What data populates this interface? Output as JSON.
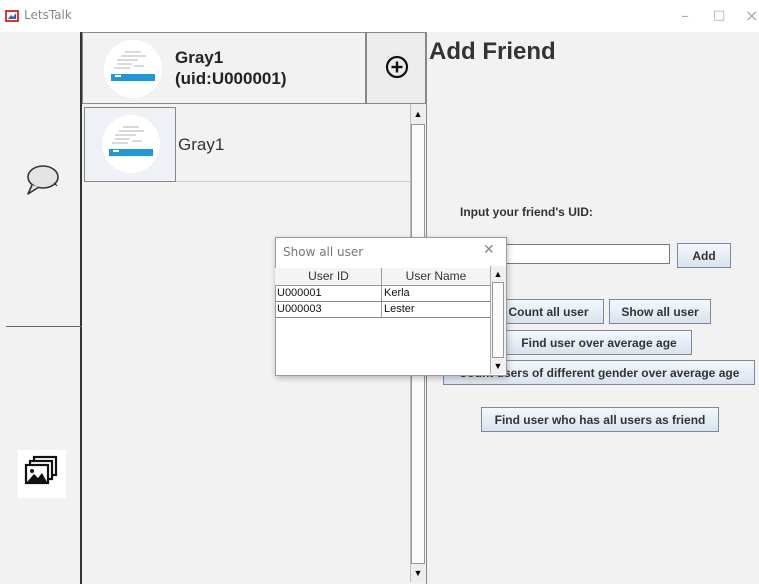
{
  "window": {
    "title": "LetsTalk"
  },
  "profile": {
    "name": "Gray1",
    "uid_line": "(uid:U000001)"
  },
  "chat_list": [
    {
      "name": "Gray1"
    }
  ],
  "add_friend": {
    "heading": "Add Friend",
    "uid_label": "Input your friend's UID:",
    "uid_value": "",
    "add_label": "Add",
    "count_label": "Count all user",
    "show_label": "Show all user",
    "avg_age_label": "Find user over average age",
    "gender_label": "Count users of different gender over average age",
    "all_friend_label": "Find user who has all users as friend"
  },
  "dialog": {
    "title": "Show all user",
    "columns": [
      "User ID",
      "User Name"
    ],
    "rows": [
      {
        "id": "U000001",
        "name": "Kerla"
      },
      {
        "id": "U000003",
        "name": "Lester"
      }
    ]
  },
  "icons": {
    "chat": "speech-bubble-icon",
    "photos": "images-icon",
    "add": "plus-circle-icon"
  }
}
